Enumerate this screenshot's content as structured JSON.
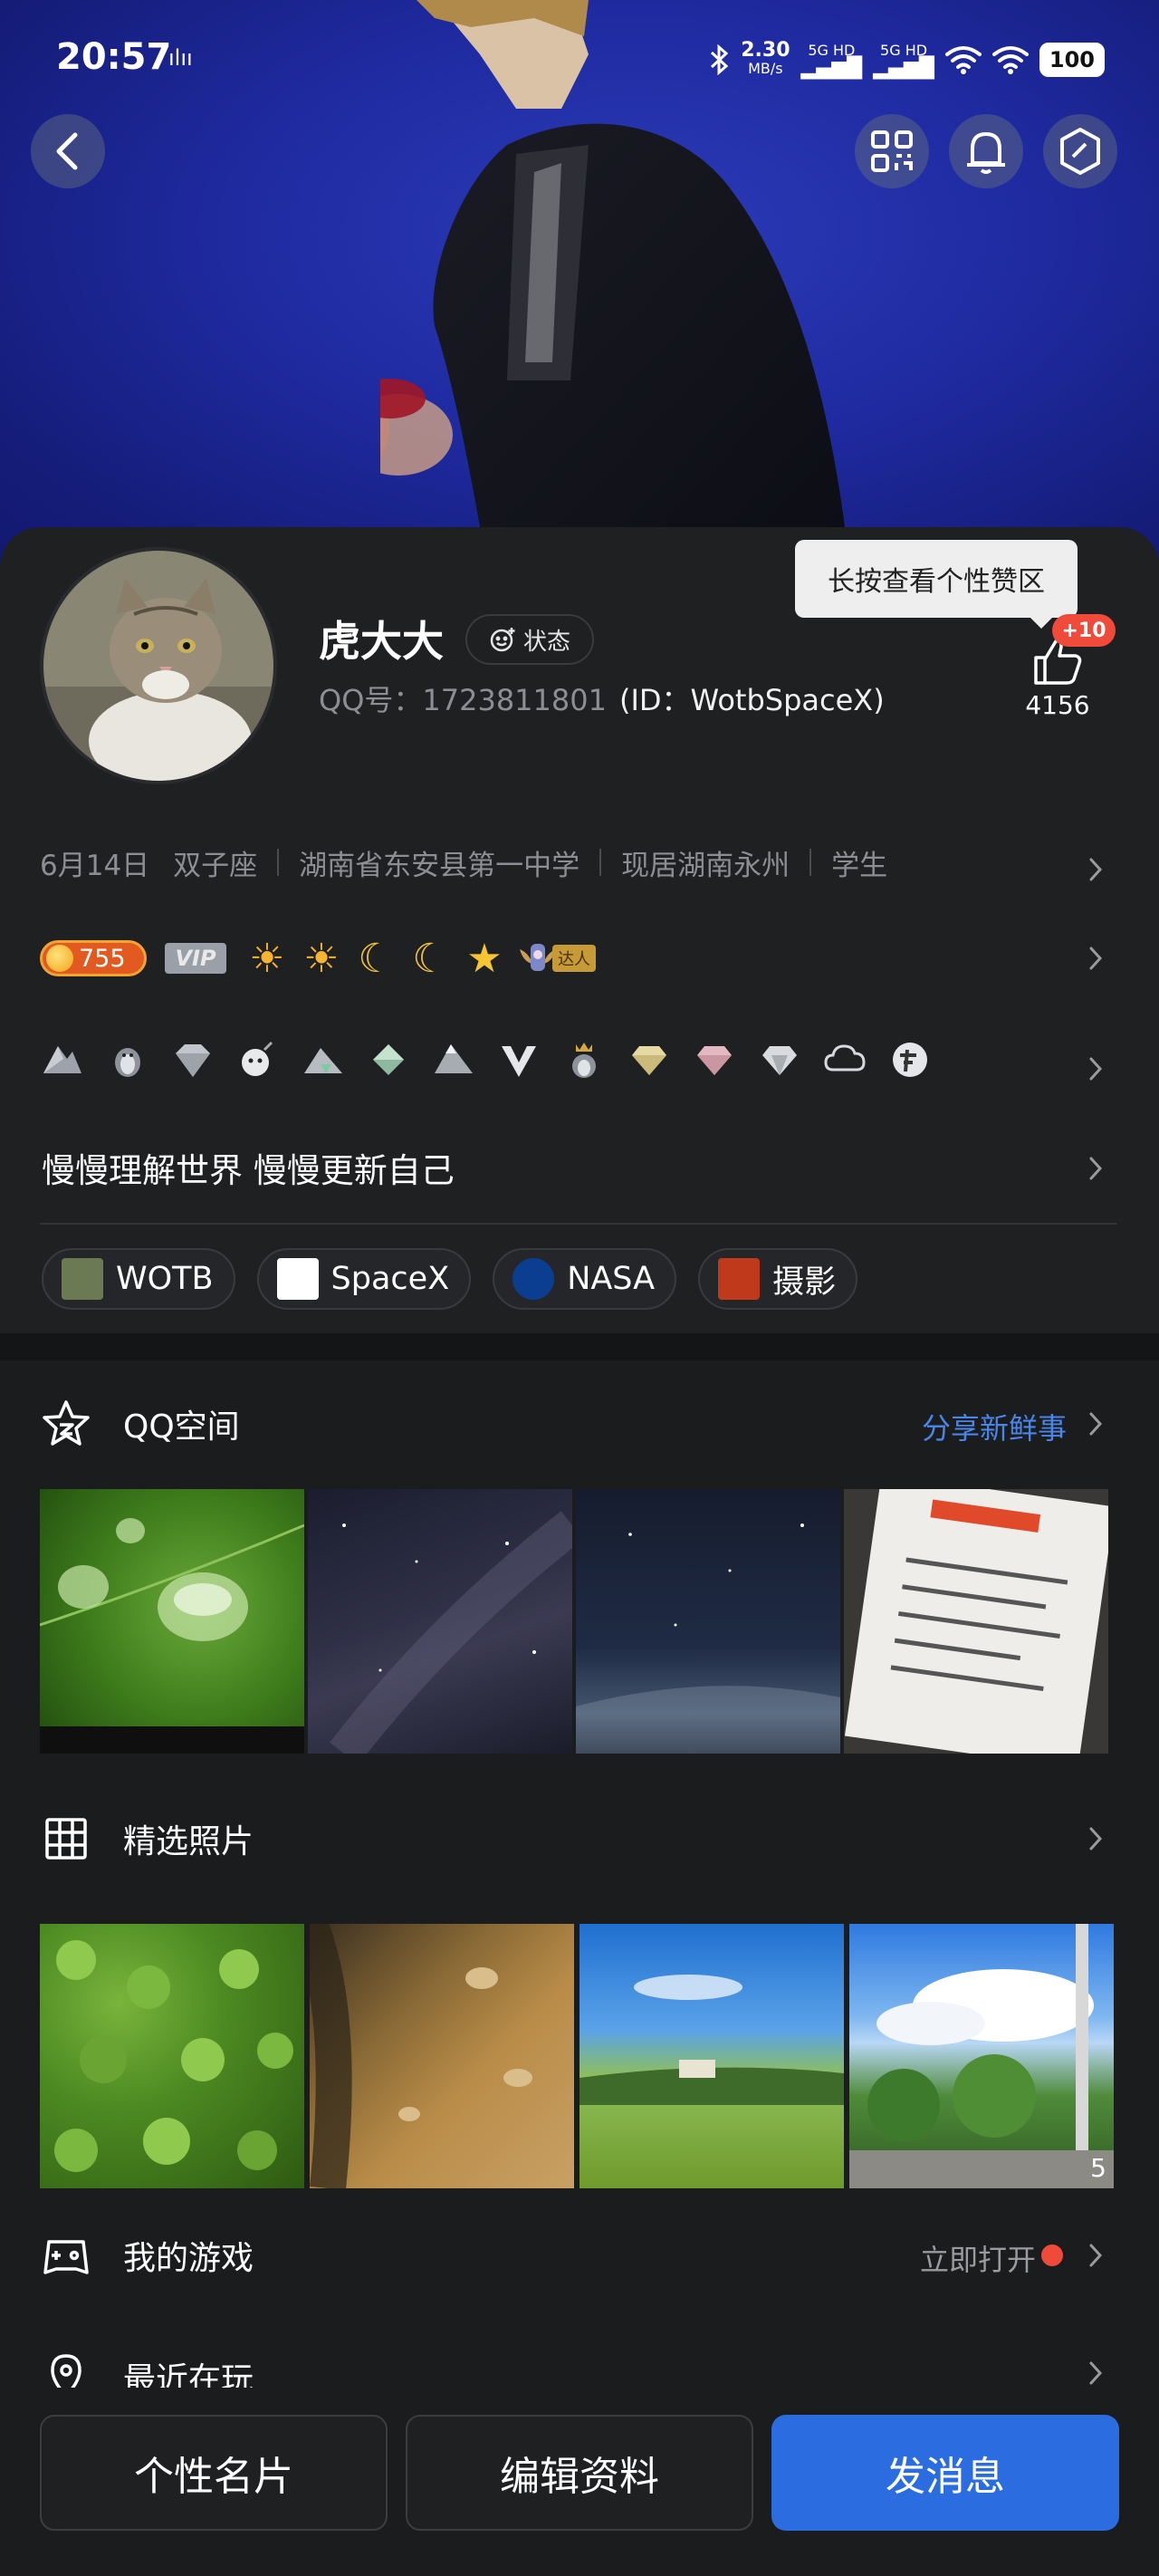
{
  "status_bar": {
    "time": "20:57",
    "net_speed": "2.30",
    "net_unit": "MB/s",
    "signal1": "5G HD",
    "signal2": "5G HD",
    "battery": "100"
  },
  "header": {
    "back_icon": "chevron-left-icon",
    "qr_icon": "qrcode-icon",
    "bell_icon": "bell-icon",
    "settings_icon": "hexagon-settings-icon"
  },
  "profile": {
    "name": "虎大大",
    "state_label": "状态",
    "qq_label": "QQ号：1723811801",
    "id_label": "(ID：WotbSpaceX)",
    "like_tooltip": "长按查看个性赞区",
    "like_badge": "+10",
    "like_count": "4156",
    "info": [
      "6月14日",
      "双子座",
      "湖南省东安县第一中学",
      "现居湖南永州",
      "学生"
    ],
    "level_value": "755",
    "vip_label": "VIP",
    "daren_label": "达人",
    "signature": "慢慢理解世界 慢慢更新自己",
    "tags": [
      {
        "label": "WOTB",
        "color": "#6b7a52"
      },
      {
        "label": "SpaceX",
        "color": "#ffffff"
      },
      {
        "label": "NASA",
        "color": "#0b3d91"
      },
      {
        "label": "摄影",
        "color": "#c0391b"
      }
    ]
  },
  "qzone": {
    "title": "QQ空间",
    "action": "分享新鲜事",
    "action_color": "#4a86e8"
  },
  "selected_photos": {
    "title": "精选照片",
    "count_badge": "5"
  },
  "games": {
    "title": "我的游戏",
    "action": "立即打开",
    "dot_color": "#ef4a3a"
  },
  "recent": {
    "title": "最近在玩"
  },
  "bottom": {
    "card_button": "个性名片",
    "edit_button": "编辑资料",
    "message_button": "发消息"
  }
}
